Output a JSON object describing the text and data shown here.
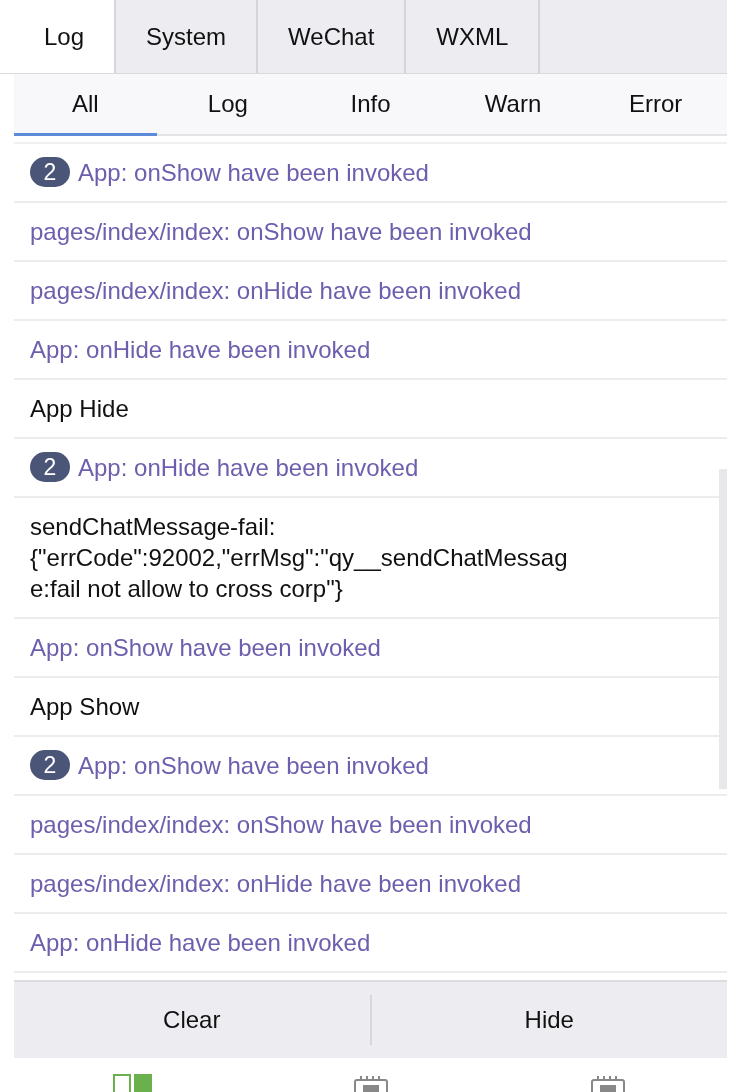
{
  "tabs": [
    {
      "label": "Log",
      "selected": true
    },
    {
      "label": "System",
      "selected": false
    },
    {
      "label": "WeChat",
      "selected": false
    },
    {
      "label": "WXML",
      "selected": false
    }
  ],
  "filters": [
    {
      "label": "All",
      "selected": true
    },
    {
      "label": "Log",
      "selected": false
    },
    {
      "label": "Info",
      "selected": false
    },
    {
      "label": "Warn",
      "selected": false
    },
    {
      "label": "Error",
      "selected": false
    }
  ],
  "entries": [
    {
      "kind": "system",
      "count": "2",
      "text": "App: onShow have been invoked"
    },
    {
      "kind": "system",
      "text": "pages/index/index: onShow have been invoked"
    },
    {
      "kind": "system",
      "text": "pages/index/index: onHide have been invoked"
    },
    {
      "kind": "system",
      "text": "App: onHide have been invoked"
    },
    {
      "kind": "log",
      "text": "App Hide"
    },
    {
      "kind": "system",
      "count": "2",
      "text": "App: onHide have been invoked"
    },
    {
      "kind": "log",
      "text": "sendChatMessage-fail:\n{\"errCode\":92002,\"errMsg\":\"qy__sendChatMessag\ne:fail not allow to cross corp\"}"
    },
    {
      "kind": "system",
      "text": "App: onShow have been invoked"
    },
    {
      "kind": "log",
      "text": "App Show"
    },
    {
      "kind": "system",
      "count": "2",
      "text": "App: onShow have been invoked"
    },
    {
      "kind": "system",
      "text": "pages/index/index: onShow have been invoked"
    },
    {
      "kind": "system",
      "text": "pages/index/index: onHide have been invoked"
    },
    {
      "kind": "system",
      "text": "App: onHide have been invoked"
    }
  ],
  "footer_buttons": [
    "Clear",
    "Hide"
  ],
  "bottom_bar": [
    {
      "kind": "grid",
      "selected": true
    },
    {
      "kind": "chip",
      "selected": false
    },
    {
      "kind": "chip",
      "selected": false
    }
  ]
}
